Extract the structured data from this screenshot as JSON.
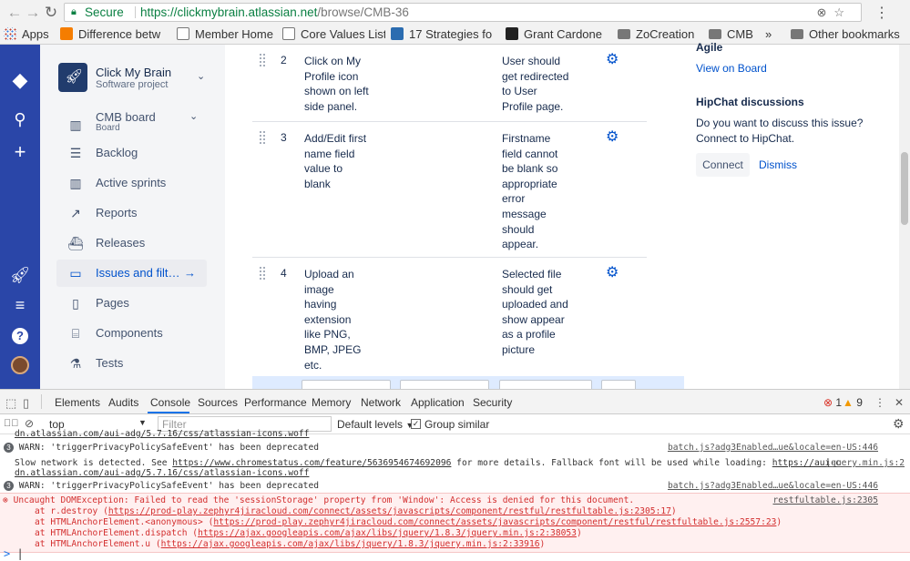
{
  "browser": {
    "secure_label": "Secure",
    "url_host": "https://clickmybrain.atlassian.net",
    "url_path": "/browse/CMB-36",
    "bookmarks": [
      {
        "label": "Apps",
        "icon": "apps-grid-icon"
      },
      {
        "label": "Difference betw",
        "icon": "blogger-icon"
      },
      {
        "label": "Member Home",
        "icon": "page-icon"
      },
      {
        "label": "Core Values List",
        "icon": "page-icon"
      },
      {
        "label": "17 Strategies fo",
        "icon": "yahoo-icon"
      },
      {
        "label": "Grant Cardone",
        "icon": "e-icon"
      },
      {
        "label": "ZoCreation",
        "icon": "folder-icon"
      },
      {
        "label": "CMB",
        "icon": "folder-icon"
      },
      {
        "label": "»",
        "icon": ""
      },
      {
        "label": "Other bookmarks",
        "icon": "folder-icon"
      }
    ]
  },
  "project": {
    "name": "Click My Brain",
    "type": "Software project",
    "board_name": "CMB board",
    "board_sub": "Board"
  },
  "nav": [
    {
      "label": "Backlog",
      "icon": "backlog-icon"
    },
    {
      "label": "Active sprints",
      "icon": "columns-icon"
    },
    {
      "label": "Reports",
      "icon": "chart-icon"
    },
    {
      "label": "Releases",
      "icon": "ship-icon"
    },
    {
      "label": "Issues and filt…",
      "icon": "issues-icon"
    },
    {
      "label": "Pages",
      "icon": "page-icon"
    },
    {
      "label": "Components",
      "icon": "component-icon"
    },
    {
      "label": "Tests",
      "icon": "flask-icon"
    }
  ],
  "steps": [
    {
      "num": "2",
      "step": [
        "Click on My",
        "Profile icon",
        "shown on left",
        "side panel."
      ],
      "result": [
        "User should",
        "get redirected",
        "to User",
        "Profile page."
      ]
    },
    {
      "num": "3",
      "step": [
        "Add/Edit first",
        "name field",
        "value to",
        "blank"
      ],
      "result": [
        "Firstname",
        "field cannot",
        "be blank so",
        "appropriate",
        "error",
        "message",
        "should",
        "appear."
      ]
    },
    {
      "num": "4",
      "step": [
        "Upload an",
        "image",
        "having",
        "extension",
        "like PNG,",
        "BMP, JPEG",
        "etc."
      ],
      "result": [
        "Selected file",
        "should get",
        "uploaded and",
        "show appear",
        "as a profile",
        "picture"
      ]
    }
  ],
  "right": {
    "agile_heading": "Agile",
    "view_on_board": "View on Board",
    "hipchat_heading": "HipChat discussions",
    "hipchat_text_1": "Do you want to discuss this issue?",
    "hipchat_text_2": "Connect to HipChat.",
    "connect_label": "Connect",
    "dismiss_label": "Dismiss"
  },
  "devtools": {
    "tabs": [
      "Elements",
      "Audits",
      "Console",
      "Sources",
      "Performance",
      "Memory",
      "Network",
      "Application",
      "Security"
    ],
    "active_tab": "Console",
    "error_count": "1",
    "warning_count": "9",
    "context": "top",
    "filter_placeholder": "Filter",
    "levels": "Default levels",
    "group_similar": "Group similar",
    "lines": [
      {
        "kind": "text",
        "text": "dn.atlassian.com/aui-adg/5.7.16/css/atlassian-icons.woff"
      },
      {
        "kind": "warn",
        "count": "3",
        "text": "WARN: 'triggerPrivacyPolicySafeEvent' has been deprecated",
        "source": "batch.js?adg3Enabled…ue&locale=en-US:446"
      },
      {
        "kind": "info",
        "text_pre": "Slow network is detected. See ",
        "link1": "https://www.chromestatus.com/feature/5636954674692096",
        "text_mid": " for more details. Fallback font will be used while loading: ",
        "link2": "https://aui-c",
        "source": "jquery.min.js:2"
      },
      {
        "kind": "text",
        "text": "dn.atlassian.com/aui-adg/5.7.16/css/atlassian-icons.woff"
      },
      {
        "kind": "warn",
        "count": "3",
        "text": "WARN: 'triggerPrivacyPolicySafeEvent' has been deprecated",
        "source": "batch.js?adg3Enabled…ue&locale=en-US:446"
      }
    ],
    "error": {
      "message": "Uncaught DOMException: Failed to read the 'sessionStorage' property from 'Window': Access is denied for this document.",
      "source": "restfultable.js:2305",
      "stack": [
        {
          "pre": "at r.destroy (",
          "link": "https://prod-play.zephyr4jiracloud.com/connect/assets/javascripts/component/restful/restfultable.js:2305:17",
          "post": ")"
        },
        {
          "pre": "at HTMLAnchorElement.<anonymous> (",
          "link": "https://prod-play.zephyr4jiracloud.com/connect/assets/javascripts/component/restful/restfultable.js:2557:23",
          "post": ")"
        },
        {
          "pre": "at HTMLAnchorElement.dispatch (",
          "link": "https://ajax.googleapis.com/ajax/libs/jquery/1.8.3/jquery.min.js:2:38053",
          "post": ")"
        },
        {
          "pre": "at HTMLAnchorElement.u (",
          "link": "https://ajax.googleapis.com/ajax/libs/jquery/1.8.3/jquery.min.js:2:33916",
          "post": ")"
        }
      ]
    },
    "prompt": ">"
  }
}
